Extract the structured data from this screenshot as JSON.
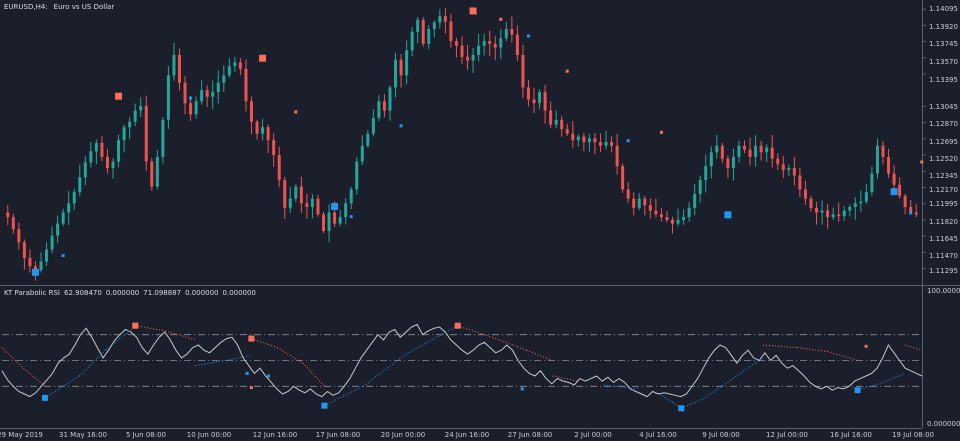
{
  "window": {
    "symbol_timeframe": "EURUSD,H4:",
    "symbol_desc": "Euro vs US Dollar"
  },
  "price_axis": {
    "labels": [
      "1.14095",
      "1.13920",
      "1.13745",
      "1.13570",
      "1.13395",
      "1.13045",
      "1.12870",
      "1.12695",
      "1.12520",
      "1.12345",
      "1.12170",
      "1.11995",
      "1.11820",
      "1.11645",
      "1.11470",
      "1.11295"
    ],
    "values": [
      1.14095,
      1.1392,
      1.13745,
      1.1357,
      1.13395,
      1.13045,
      1.1287,
      1.12695,
      1.1252,
      1.12345,
      1.1217,
      1.11995,
      1.1182,
      1.11645,
      1.1147,
      1.11295
    ]
  },
  "indicator": {
    "name": "KT Parabolic RSI",
    "values_text": [
      "62.908470",
      "0.000000",
      "71.098887",
      "0.000000",
      "0.000000"
    ],
    "axis_top_label": "100.000000",
    "axis_bottom_label": "0.000000",
    "overbought": 70,
    "oversold": 30,
    "middle": 50
  },
  "time_axis": {
    "labels": [
      "29 May 2019",
      "31 May 16:00",
      "5 Jun 08:00",
      "10 Jun 00:00",
      "12 Jun 16:00",
      "17 Jun 08:00",
      "20 Jun 00:00",
      "24 Jun 16:00",
      "27 Jun 08:00",
      "2 Jul 00:00",
      "4 Jul 16:00",
      "9 Jul 08:00",
      "12 Jul 00:00",
      "16 Jul 16:00",
      "19 Jul 08:00"
    ]
  },
  "colors": {
    "background": "#1b1f2c",
    "bull_candle": "#26a69a",
    "bear_candle": "#ef5350",
    "sar_bull": "#2196f3",
    "sar_bear": "#ff6e5a",
    "rsi_line": "#c8c8c8",
    "grid_dash": "#8a8f9a",
    "separator": "#5a606c"
  },
  "chart_data": [
    {
      "type": "candlestick",
      "title": "EURUSD,H4: Euro vs US Dollar",
      "ylim": [
        1.1115,
        1.1415
      ],
      "close_path": [
        1.1185,
        1.1172,
        1.1158,
        1.1141,
        1.1132,
        1.1128,
        1.1137,
        1.115,
        1.1165,
        1.1178,
        1.119,
        1.12,
        1.1212,
        1.1228,
        1.1244,
        1.1256,
        1.1265,
        1.125,
        1.1238,
        1.1245,
        1.1268,
        1.1282,
        1.1288,
        1.13,
        1.1305,
        1.1245,
        1.1218,
        1.125,
        1.129,
        1.1338,
        1.136,
        1.133,
        1.1308,
        1.1296,
        1.131,
        1.1322,
        1.1315,
        1.132,
        1.133,
        1.1338,
        1.1348,
        1.1352,
        1.1345,
        1.131,
        1.1288,
        1.1275,
        1.1282,
        1.1268,
        1.1252,
        1.1225,
        1.1195,
        1.1205,
        1.1218,
        1.12,
        1.1196,
        1.1205,
        1.1188,
        1.117,
        1.119,
        1.1178,
        1.1185,
        1.12,
        1.1215,
        1.1245,
        1.1262,
        1.1275,
        1.1292,
        1.131,
        1.13,
        1.1325,
        1.1355,
        1.1338,
        1.1365,
        1.1385,
        1.1398,
        1.1372,
        1.1388,
        1.1395,
        1.1402,
        1.1396,
        1.1375,
        1.137,
        1.1358,
        1.1354,
        1.136,
        1.137,
        1.1375,
        1.1372,
        1.1368,
        1.1378,
        1.1388,
        1.1382,
        1.136,
        1.1325,
        1.1312,
        1.1308,
        1.132,
        1.13,
        1.1285,
        1.129,
        1.128,
        1.1275,
        1.1268,
        1.1272,
        1.1266,
        1.127,
        1.1266,
        1.1262,
        1.1266,
        1.1262,
        1.124,
        1.1215,
        1.1205,
        1.1195,
        1.1205,
        1.1198,
        1.1192,
        1.1188,
        1.1185,
        1.1182,
        1.1178,
        1.1182,
        1.1185,
        1.1195,
        1.121,
        1.1225,
        1.124,
        1.1255,
        1.1262,
        1.1248,
        1.1238,
        1.125,
        1.1262,
        1.1258,
        1.125,
        1.1262,
        1.1255,
        1.126,
        1.1248,
        1.1242,
        1.1236,
        1.1238,
        1.123,
        1.1215,
        1.1205,
        1.1195,
        1.119,
        1.1192,
        1.1185,
        1.1188,
        1.1186,
        1.1192,
        1.1196,
        1.12,
        1.1202,
        1.1212,
        1.1232,
        1.1262,
        1.125,
        1.1232,
        1.122,
        1.1208,
        1.1196,
        1.119,
        1.1188
      ],
      "sar_points": [
        {
          "t": 5,
          "price": 1.11255,
          "side": "bull",
          "kind": "signal"
        },
        {
          "t": 10,
          "price": 1.11435,
          "side": "bull",
          "kind": "trail"
        },
        {
          "t": 20,
          "price": 1.13155,
          "side": "bear",
          "kind": "signal"
        },
        {
          "t": 33,
          "price": 1.13135,
          "side": "bull",
          "kind": "trail"
        },
        {
          "t": 46,
          "price": 1.13565,
          "side": "bear",
          "kind": "signal"
        },
        {
          "t": 52,
          "price": 1.12985,
          "side": "bear",
          "kind": "trail"
        },
        {
          "t": 59,
          "price": 1.11965,
          "side": "bull",
          "kind": "signal"
        },
        {
          "t": 62,
          "price": 1.11855,
          "side": "bull",
          "kind": "trail"
        },
        {
          "t": 71,
          "price": 1.12835,
          "side": "bull",
          "kind": "trail"
        },
        {
          "t": 84,
          "price": 1.14075,
          "side": "bear",
          "kind": "signal"
        },
        {
          "t": 89,
          "price": 1.13985,
          "side": "bear",
          "kind": "trail"
        },
        {
          "t": 94,
          "price": 1.13805,
          "side": "bull",
          "kind": "trail"
        },
        {
          "t": 101,
          "price": 1.13425,
          "side": "bear",
          "kind": "trail"
        },
        {
          "t": 112,
          "price": 1.12675,
          "side": "bull",
          "kind": "trail"
        },
        {
          "t": 118,
          "price": 1.12765,
          "side": "bear",
          "kind": "trail"
        },
        {
          "t": 130,
          "price": 1.11875,
          "side": "bull",
          "kind": "signal"
        },
        {
          "t": 160,
          "price": 1.12125,
          "side": "bull",
          "kind": "signal"
        },
        {
          "t": 163,
          "price": 1.11895,
          "side": "bull",
          "kind": "trail"
        },
        {
          "t": 165,
          "price": 1.12445,
          "side": "bear",
          "kind": "trail"
        }
      ]
    },
    {
      "type": "line",
      "title": "KT Parabolic RSI",
      "ylim": [
        0,
        100
      ],
      "levels": [
        30,
        50,
        70
      ],
      "rsi": [
        42,
        35,
        30,
        26,
        24,
        22,
        25,
        30,
        35,
        40,
        48,
        52,
        55,
        62,
        70,
        75,
        68,
        60,
        52,
        58,
        65,
        70,
        74,
        72,
        68,
        60,
        55,
        62,
        68,
        72,
        66,
        58,
        52,
        55,
        60,
        62,
        58,
        56,
        60,
        64,
        67,
        68,
        62,
        52,
        46,
        40,
        44,
        38,
        33,
        28,
        24,
        26,
        30,
        27,
        25,
        28,
        24,
        22,
        26,
        23,
        25,
        30,
        36,
        44,
        52,
        58,
        64,
        70,
        66,
        72,
        74,
        68,
        72,
        76,
        78,
        70,
        73,
        75,
        76,
        72,
        66,
        62,
        58,
        55,
        58,
        62,
        64,
        60,
        56,
        58,
        62,
        58,
        50,
        44,
        40,
        38,
        42,
        36,
        32,
        36,
        34,
        33,
        31,
        36,
        34,
        36,
        38,
        34,
        37,
        33,
        36,
        33,
        28,
        26,
        24,
        22,
        26,
        24,
        25,
        24,
        23,
        22,
        24,
        30,
        36,
        44,
        52,
        58,
        62,
        60,
        54,
        48,
        54,
        58,
        52,
        50,
        56,
        50,
        54,
        48,
        44,
        46,
        42,
        38,
        33,
        30,
        28,
        30,
        27,
        29,
        28,
        30,
        34,
        36,
        38,
        40,
        44,
        52,
        62,
        56,
        50,
        44,
        42,
        40,
        38
      ],
      "psar": [
        {
          "t": 0,
          "v": 60,
          "side": "bear"
        },
        {
          "t": 5,
          "v": 44,
          "side": "bear"
        },
        {
          "t": 10,
          "v": 30,
          "side": "bear"
        },
        {
          "t": 10,
          "v": 21,
          "side": "bull",
          "kind": "signal"
        },
        {
          "t": 18,
          "v": 38,
          "side": "bull"
        },
        {
          "t": 24,
          "v": 58,
          "side": "bull"
        },
        {
          "t": 31,
          "v": 76,
          "side": "bull"
        },
        {
          "t": 31,
          "v": 77,
          "side": "bear",
          "kind": "signal"
        },
        {
          "t": 38,
          "v": 73,
          "side": "bear"
        },
        {
          "t": 45,
          "v": 66,
          "side": "bear"
        },
        {
          "t": 45,
          "v": 46,
          "side": "bull"
        },
        {
          "t": 52,
          "v": 50,
          "side": "bull"
        },
        {
          "t": 58,
          "v": 54,
          "side": "bull"
        },
        {
          "t": 58,
          "v": 67,
          "side": "bear",
          "kind": "signal"
        },
        {
          "t": 64,
          "v": 60,
          "side": "bear"
        },
        {
          "t": 70,
          "v": 48,
          "side": "bear"
        },
        {
          "t": 75,
          "v": 30,
          "side": "bear"
        },
        {
          "t": 75,
          "v": 15,
          "side": "bull",
          "kind": "signal"
        },
        {
          "t": 84,
          "v": 30,
          "side": "bull"
        },
        {
          "t": 94,
          "v": 55,
          "side": "bull"
        },
        {
          "t": 106,
          "v": 77,
          "side": "bull"
        },
        {
          "t": 106,
          "v": 77,
          "side": "bear",
          "kind": "signal"
        },
        {
          "t": 114,
          "v": 68,
          "side": "bear"
        },
        {
          "t": 122,
          "v": 58,
          "side": "bear"
        },
        {
          "t": 128,
          "v": 50,
          "side": "bear"
        },
        {
          "t": 128,
          "v": 38,
          "side": "bear"
        },
        {
          "t": 134,
          "v": 34,
          "side": "bear"
        },
        {
          "t": 140,
          "v": 31,
          "side": "bull"
        },
        {
          "t": 148,
          "v": 28,
          "side": "bull"
        },
        {
          "t": 153,
          "v": 31,
          "side": "bear"
        },
        {
          "t": 153,
          "v": 24,
          "side": "bull"
        },
        {
          "t": 158,
          "v": 13,
          "side": "bull",
          "kind": "signal"
        },
        {
          "t": 163,
          "v": 20,
          "side": "bull"
        },
        {
          "t": 170,
          "v": 36,
          "side": "bull"
        },
        {
          "t": 177,
          "v": 52,
          "side": "bull"
        },
        {
          "t": 177,
          "v": 62,
          "side": "bear"
        },
        {
          "t": 185,
          "v": 60,
          "side": "bear"
        },
        {
          "t": 192,
          "v": 57,
          "side": "bear"
        },
        {
          "t": 199,
          "v": 50,
          "side": "bear"
        },
        {
          "t": 199,
          "v": 27,
          "side": "bull",
          "kind": "signal"
        },
        {
          "t": 205,
          "v": 33,
          "side": "bull"
        },
        {
          "t": 210,
          "v": 40,
          "side": "bull"
        },
        {
          "t": 210,
          "v": 62,
          "side": "bear"
        },
        {
          "t": 214,
          "v": 58,
          "side": "bear"
        }
      ]
    }
  ]
}
